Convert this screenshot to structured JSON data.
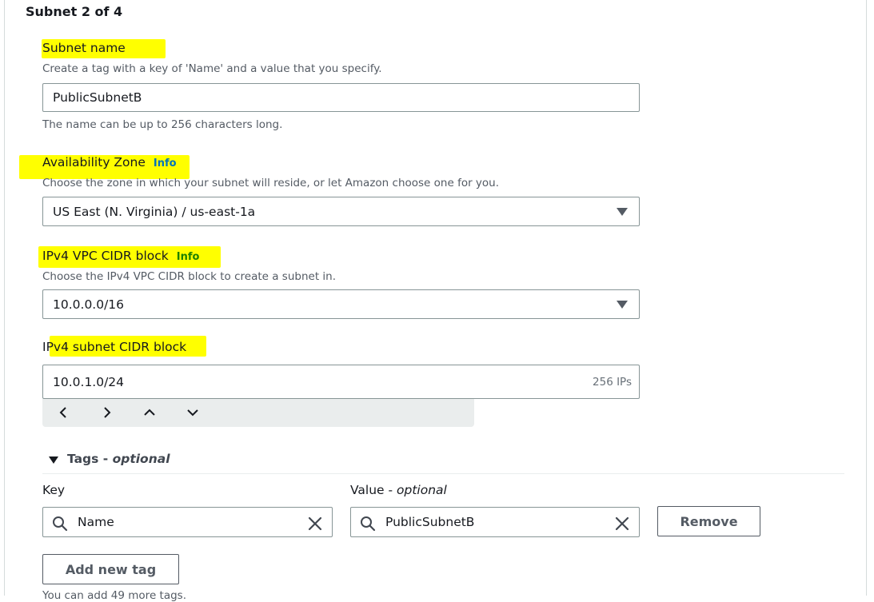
{
  "section": {
    "title": "Subnet 2 of 4"
  },
  "subnet_name": {
    "label": "Subnet name",
    "description": "Create a tag with a key of 'Name' and a value that you specify.",
    "value": "PublicSubnetB",
    "hint": "The name can be up to 256 characters long."
  },
  "availability_zone": {
    "label": "Availability Zone",
    "info": "Info",
    "description": "Choose the zone in which your subnet will reside, or let Amazon choose one for you.",
    "selected": "US East (N. Virginia) / us-east-1a"
  },
  "ipv4_vpc_cidr": {
    "label": "IPv4 VPC CIDR block",
    "info": "Info",
    "description": "Choose the IPv4 VPC CIDR block to create a subnet in.",
    "selected": "10.0.0.0/16"
  },
  "ipv4_subnet_cidr": {
    "label": "IPv4 subnet CIDR block",
    "value": "10.0.1.0/24",
    "suffix": "256 IPs"
  },
  "tags": {
    "title": "Tags - ",
    "title_optional": "optional",
    "key_label": "Key",
    "value_label": "Value - ",
    "value_label_optional": "optional",
    "key_value": "Name",
    "value_value": "PublicSubnetB",
    "remove_label": "Remove",
    "add_label": "Add new tag",
    "footer": "You can add 49 more tags."
  },
  "colors": {
    "highlight": "#ffff00",
    "info_blue": "#0073bb",
    "info_green": "#1d8102"
  }
}
